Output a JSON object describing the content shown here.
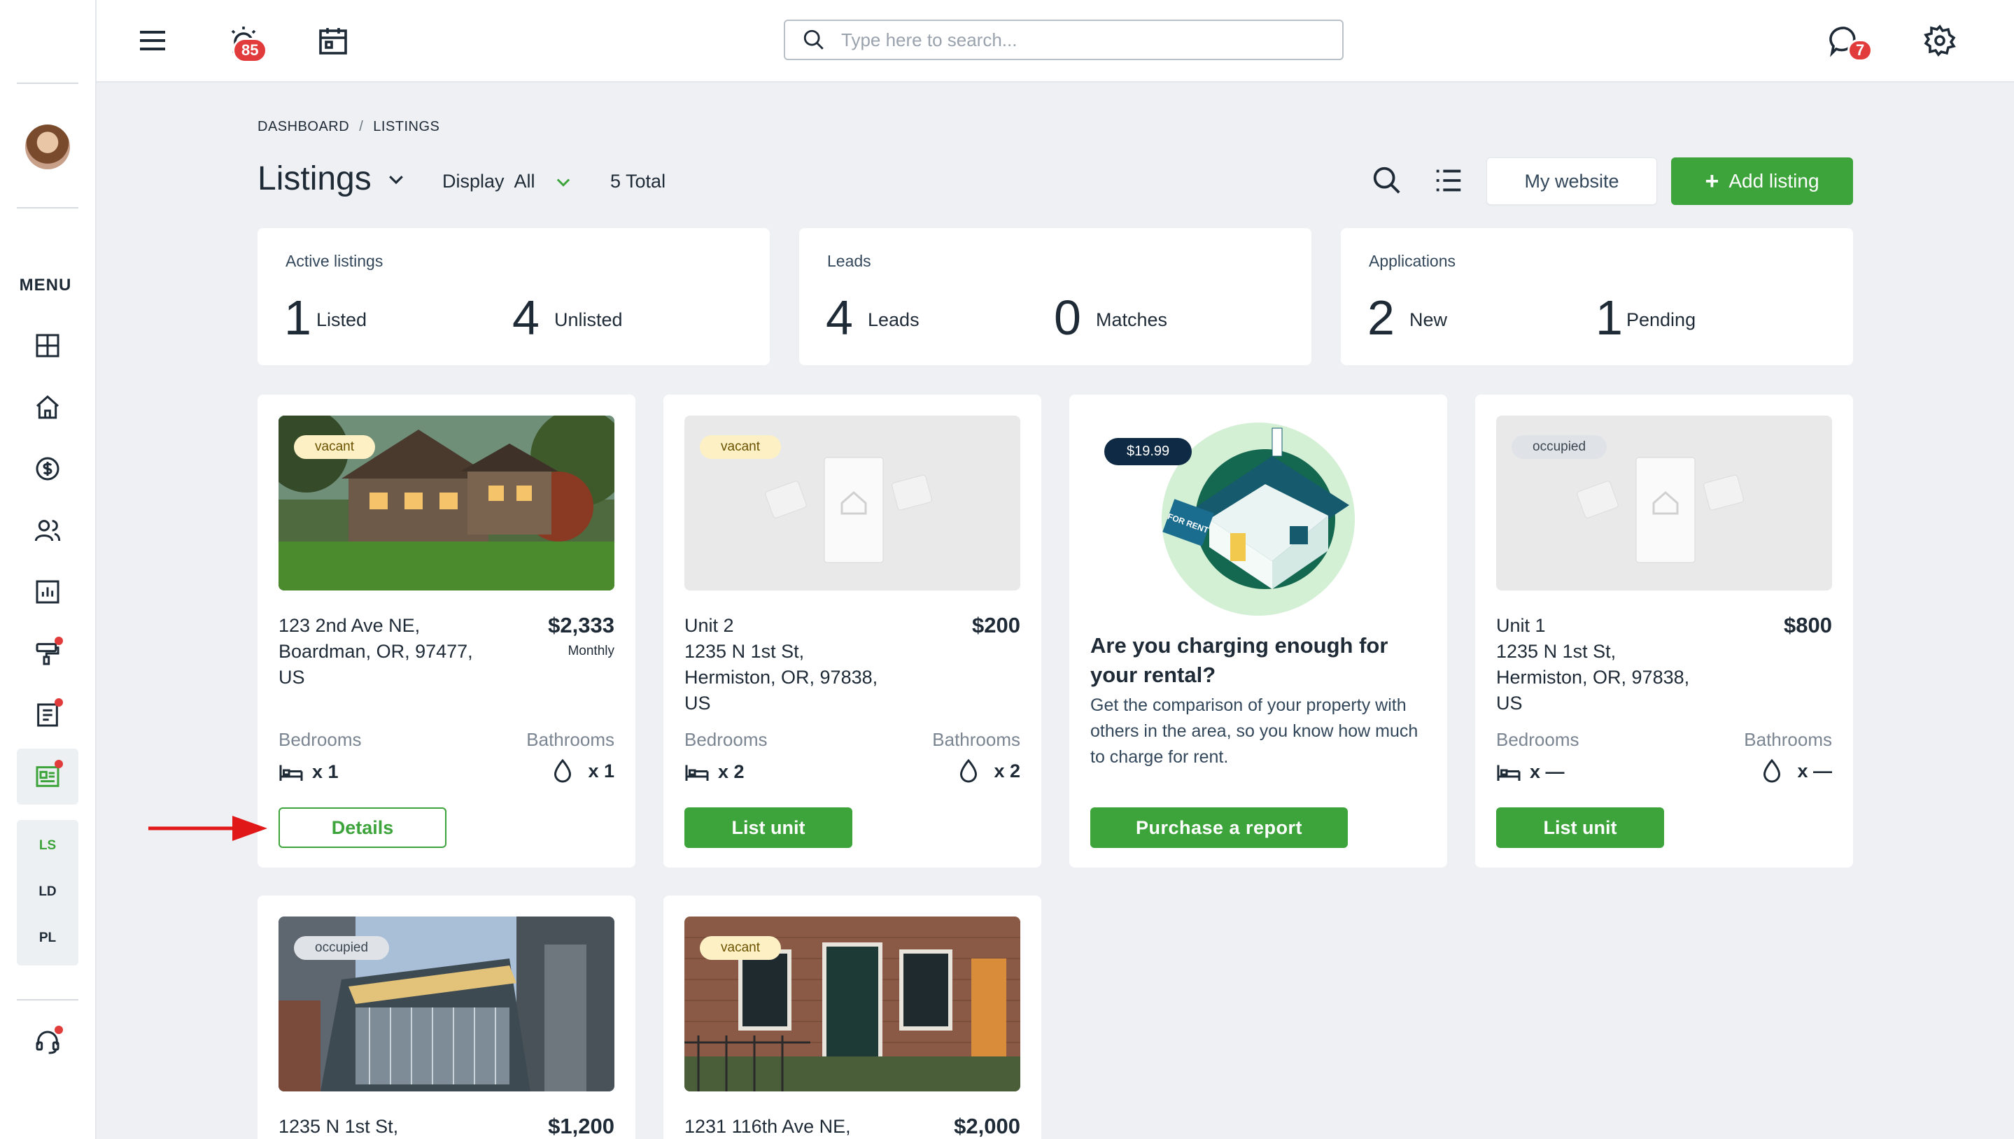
{
  "topbar": {
    "alarm_badge": "85",
    "chat_badge": "7",
    "search_placeholder": "Type here to search..."
  },
  "sidebar": {
    "menu_label": "MENU",
    "sub_items": [
      "LS",
      "LD",
      "PL"
    ]
  },
  "breadcrumb": {
    "items": [
      "DASHBOARD",
      "LISTINGS"
    ],
    "separator": "/"
  },
  "header": {
    "title": "Listings",
    "display_label": "Display",
    "display_value": "All",
    "total": "5 Total",
    "my_website": "My website",
    "add_listing": "Add listing"
  },
  "stats": [
    {
      "label": "Active listings",
      "a_num": "1",
      "a_label": "Listed",
      "b_num": "4",
      "b_label": "Unlisted"
    },
    {
      "label": "Leads",
      "a_num": "4",
      "a_label": "Leads",
      "b_num": "0",
      "b_label": "Matches"
    },
    {
      "label": "Applications",
      "a_num": "2",
      "a_label": "New",
      "b_num": "1",
      "b_label": "Pending"
    }
  ],
  "listings": [
    {
      "status": "vacant",
      "address": [
        "123 2nd Ave NE,",
        "Boardman, OR, 97477,",
        "US"
      ],
      "price": "$2,333",
      "frequency": "Monthly",
      "bedrooms_label": "Bedrooms",
      "bathrooms_label": "Bathrooms",
      "bedrooms": "x 1",
      "bathrooms": "x 1",
      "action": "Details"
    },
    {
      "status": "vacant",
      "address": [
        "Unit 2",
        "1235 N 1st St,",
        "Hermiston, OR, 97838,",
        "US"
      ],
      "price": "$200",
      "bedrooms_label": "Bedrooms",
      "bathrooms_label": "Bathrooms",
      "bedrooms": "x 2",
      "bathrooms": "x 2",
      "action": "List unit"
    },
    {
      "status": "occupied",
      "address": [
        "Unit 1",
        "1235 N 1st St,",
        "Hermiston, OR, 97838,",
        "US"
      ],
      "price": "$800",
      "bedrooms_label": "Bedrooms",
      "bathrooms_label": "Bathrooms",
      "bedrooms": "x —",
      "bathrooms": "x —",
      "action": "List unit"
    },
    {
      "status": "occupied",
      "address": [
        "1235 N 1st St,"
      ],
      "price": "$1,200"
    },
    {
      "status": "vacant",
      "address": [
        "1231 116th Ave NE,"
      ],
      "price": "$2,000"
    }
  ],
  "promo": {
    "price": "$19.99",
    "sign_text": "FOR RENT",
    "title": "Are you charging enough for your rental?",
    "body": "Get the comparison of your property with others in the area, so you know how much to charge for rent.",
    "button": "Purchase a report"
  },
  "colors": {
    "accent_green": "#3ca43a",
    "badge_red": "#e23b3b",
    "navy": "#0f2a44"
  }
}
